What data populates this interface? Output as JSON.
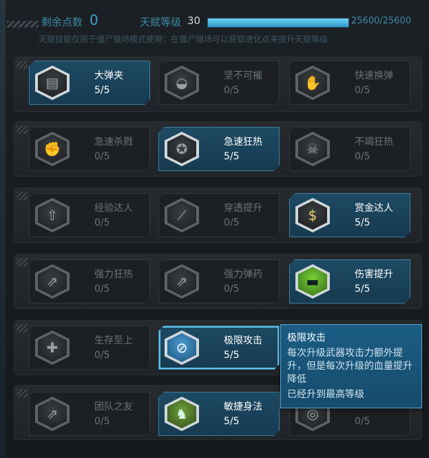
{
  "header": {
    "remaining_label": "剩余点数",
    "remaining_value": "0",
    "level_label": "天赋等级",
    "level_value": "30",
    "xp_text": "25600/25600",
    "xp_progress": 1.0,
    "hint": "天赋技能仅限于僵尸猎场模式使用；在僵尸猎场可以获取进化点来提升天赋等级"
  },
  "talents": [
    {
      "name": "大弹夹",
      "level": "5/5",
      "icon": "magazine-icon",
      "active": true
    },
    {
      "name": "坚不可摧",
      "level": "0/5",
      "icon": "helmet-icon",
      "active": false
    },
    {
      "name": "快速换弹",
      "level": "0/5",
      "icon": "reload-hand-icon",
      "active": false
    },
    {
      "name": "急速杀戮",
      "level": "0/5",
      "icon": "knife-hand-icon",
      "active": false
    },
    {
      "name": "急速狂热",
      "level": "5/5",
      "icon": "speed-badge-icon",
      "active": true
    },
    {
      "name": "不竭狂热",
      "level": "0/5",
      "icon": "skull-icon",
      "active": false
    },
    {
      "name": "经验达人",
      "level": "0/5",
      "icon": "exp-up-icon",
      "active": false
    },
    {
      "name": "穿透提升",
      "level": "0/5",
      "icon": "penetration-icon",
      "active": false
    },
    {
      "name": "赏金达人",
      "level": "5/5",
      "icon": "dollar-icon",
      "active": true
    },
    {
      "name": "强力狂热",
      "level": "0/5",
      "icon": "power-up-icon",
      "active": false
    },
    {
      "name": "强力弹药",
      "level": "0/5",
      "icon": "ammo-up-icon",
      "active": false
    },
    {
      "name": "伤害提升",
      "level": "5/5",
      "icon": "gun-icon",
      "active": true
    },
    {
      "name": "生存至上",
      "level": "0/5",
      "icon": "medic-cross-icon",
      "active": false
    },
    {
      "name": "极限攻击",
      "level": "5/5",
      "icon": "extreme-attack-icon",
      "active": true
    },
    {
      "name": "",
      "level": "",
      "icon": "hidden-icon",
      "active": false
    },
    {
      "name": "团队之友",
      "level": "0/5",
      "icon": "team-gun-icon",
      "active": false
    },
    {
      "name": "敏捷身法",
      "level": "5/5",
      "icon": "agility-icon",
      "active": true
    },
    {
      "name": "",
      "level": "0/5",
      "icon": "sixth-row-icon",
      "active": false
    }
  ],
  "tooltip": {
    "title": "极限攻击",
    "desc": "每次升级武器攻击力额外提升，但是每次升级的血量提升降低",
    "status": "已经升到最高等级"
  }
}
